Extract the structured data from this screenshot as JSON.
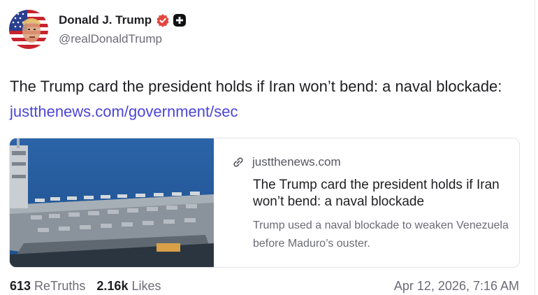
{
  "author": {
    "display_name": "Donald J. Trump",
    "handle": "@realDonaldTrump",
    "avatar_icon": "flag-portrait-avatar",
    "verified_icon": "verified-badge-icon",
    "extra_badge_icon": "plus-badge-icon"
  },
  "post": {
    "text": "The Trump card the president holds if Iran won’t bend: a naval blockade: ",
    "link_text": "justthenews.com/government/sec"
  },
  "link_card": {
    "image_icon": "aircraft-carrier-photo",
    "domain_icon": "link-icon",
    "domain": "justthenews.com",
    "title": "The Trump card the president holds if Iran won’t bend: a naval blockade",
    "description": "Trump used a naval blockade to weaken Venezuela before Maduro’s ouster."
  },
  "stats": {
    "retruths_count": "613",
    "retruths_label": "ReTruths",
    "likes_count": "2.16k",
    "likes_label": "Likes",
    "timestamp": "Apr 12, 2026, 7:16 AM"
  },
  "colors": {
    "link": "#4b45d6",
    "verified": "#e2473f",
    "text": "#1f1f23",
    "muted": "#6b6b76"
  }
}
